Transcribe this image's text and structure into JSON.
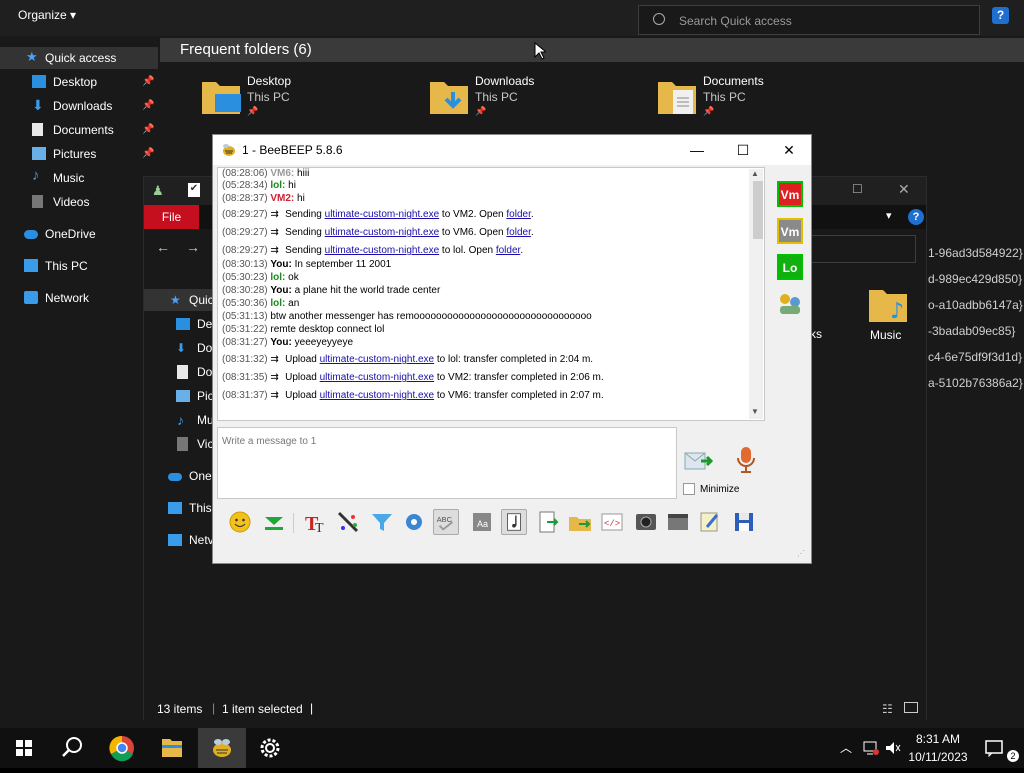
{
  "explorer": {
    "organize_label": "Organize",
    "search_placeholder": "Search Quick access",
    "nav": [
      {
        "label": "Quick access",
        "pinned": false
      },
      {
        "label": "Desktop",
        "pinned": true
      },
      {
        "label": "Downloads",
        "pinned": true
      },
      {
        "label": "Documents",
        "pinned": true
      },
      {
        "label": "Pictures",
        "pinned": true
      },
      {
        "label": "Music",
        "pinned": false
      },
      {
        "label": "Videos",
        "pinned": false
      },
      {
        "label": "OneDrive",
        "pinned": false
      },
      {
        "label": "This PC",
        "pinned": false
      },
      {
        "label": "Network",
        "pinned": false
      }
    ],
    "frequent_title": "Frequent folders (6)",
    "folders": [
      {
        "name": "Desktop",
        "location": "This PC"
      },
      {
        "name": "Downloads",
        "location": "This PC"
      },
      {
        "name": "Documents",
        "location": "This PC"
      }
    ]
  },
  "explorer2": {
    "file_tab": "File",
    "nav": [
      "Quic",
      "De",
      "Do",
      "Do",
      "Pic",
      "Mu",
      "Vic",
      "One",
      "This",
      "Netv"
    ],
    "guids": [
      "1-96ad3d584922}",
      "d-989ec429d850}",
      "o-a10adbb6147a}",
      "-3badab09ec85}",
      "c4-6e75df9f3d1d}",
      "a-5102b76386a2}"
    ],
    "tile_partial": "ks",
    "music_label": "Music",
    "status_items": "13 items",
    "status_selected": "1 item selected"
  },
  "beebeep": {
    "title": "1 - BeeBEEP 5.8.6",
    "minimize_symbol": "—",
    "maximize_symbol": "☐",
    "close_symbol": "✕",
    "messages": [
      {
        "time": "(08:28:06)",
        "sender": "VM6:",
        "text": " hiii"
      },
      {
        "time": "(05:28:34)",
        "sender": "lol:",
        "text": " hi"
      },
      {
        "time": "(08:28:37)",
        "sender": "VM2:",
        "text": " hi"
      },
      {
        "time": "(08:29:27)",
        "pre": " Sending ",
        "link": "ultimate-custom-night.exe",
        "mid": " to VM2. Open ",
        "link2": "folder",
        "post": "."
      },
      {
        "time": "(08:29:27)",
        "pre": " Sending ",
        "link": "ultimate-custom-night.exe",
        "mid": " to VM6. Open ",
        "link2": "folder",
        "post": "."
      },
      {
        "time": "(08:29:27)",
        "pre": " Sending ",
        "link": "ultimate-custom-night.exe",
        "mid": " to lol. Open ",
        "link2": "folder",
        "post": "."
      },
      {
        "time": "(08:30:13)",
        "sender": "You:",
        "text": " In september 11 2001"
      },
      {
        "time": "(05:30:23)",
        "sender": "lol:",
        "text": " ok"
      },
      {
        "time": "(08:30:28)",
        "sender": "You:",
        "text": " a plane hit the world trade center"
      },
      {
        "time": "(05:30:36)",
        "sender": "lol:",
        "text": " an"
      },
      {
        "time": "(05:31:13)",
        "text": "    btw another messenger has remoooooooooooooooooooooooooooooooo"
      },
      {
        "time": "(05:31:22)",
        "text": "    remte desktop connect lol"
      },
      {
        "time": "(08:31:27)",
        "sender": "You:",
        "text": " yeeeyeyyeye"
      },
      {
        "time": "(08:31:32)",
        "pre": " Upload ",
        "link": "ultimate-custom-night.exe",
        "mid": " to lol: transfer completed in 2:04 m."
      },
      {
        "time": "(08:31:35)",
        "pre": " Upload ",
        "link": "ultimate-custom-night.exe",
        "mid": " to VM2: transfer completed in 2:06 m."
      },
      {
        "time": "(08:31:37)",
        "pre": " Upload ",
        "link": "ultimate-custom-night.exe",
        "mid": " to VM6: transfer completed in 2:07 m."
      }
    ],
    "input_placeholder": "Write a message to 1",
    "minimize_label": "Minimize",
    "users": [
      {
        "badge": "Vm",
        "color": "#e02020",
        "border": "#00c000"
      },
      {
        "badge": "Vm",
        "color": "#8a8a8a",
        "border": "#e0c000"
      },
      {
        "badge": "Lo",
        "color": "#10b010",
        "border": "#00c000"
      }
    ]
  },
  "taskbar": {
    "time": "8:31 AM",
    "date": "10/11/2023",
    "notification_count": "2"
  }
}
